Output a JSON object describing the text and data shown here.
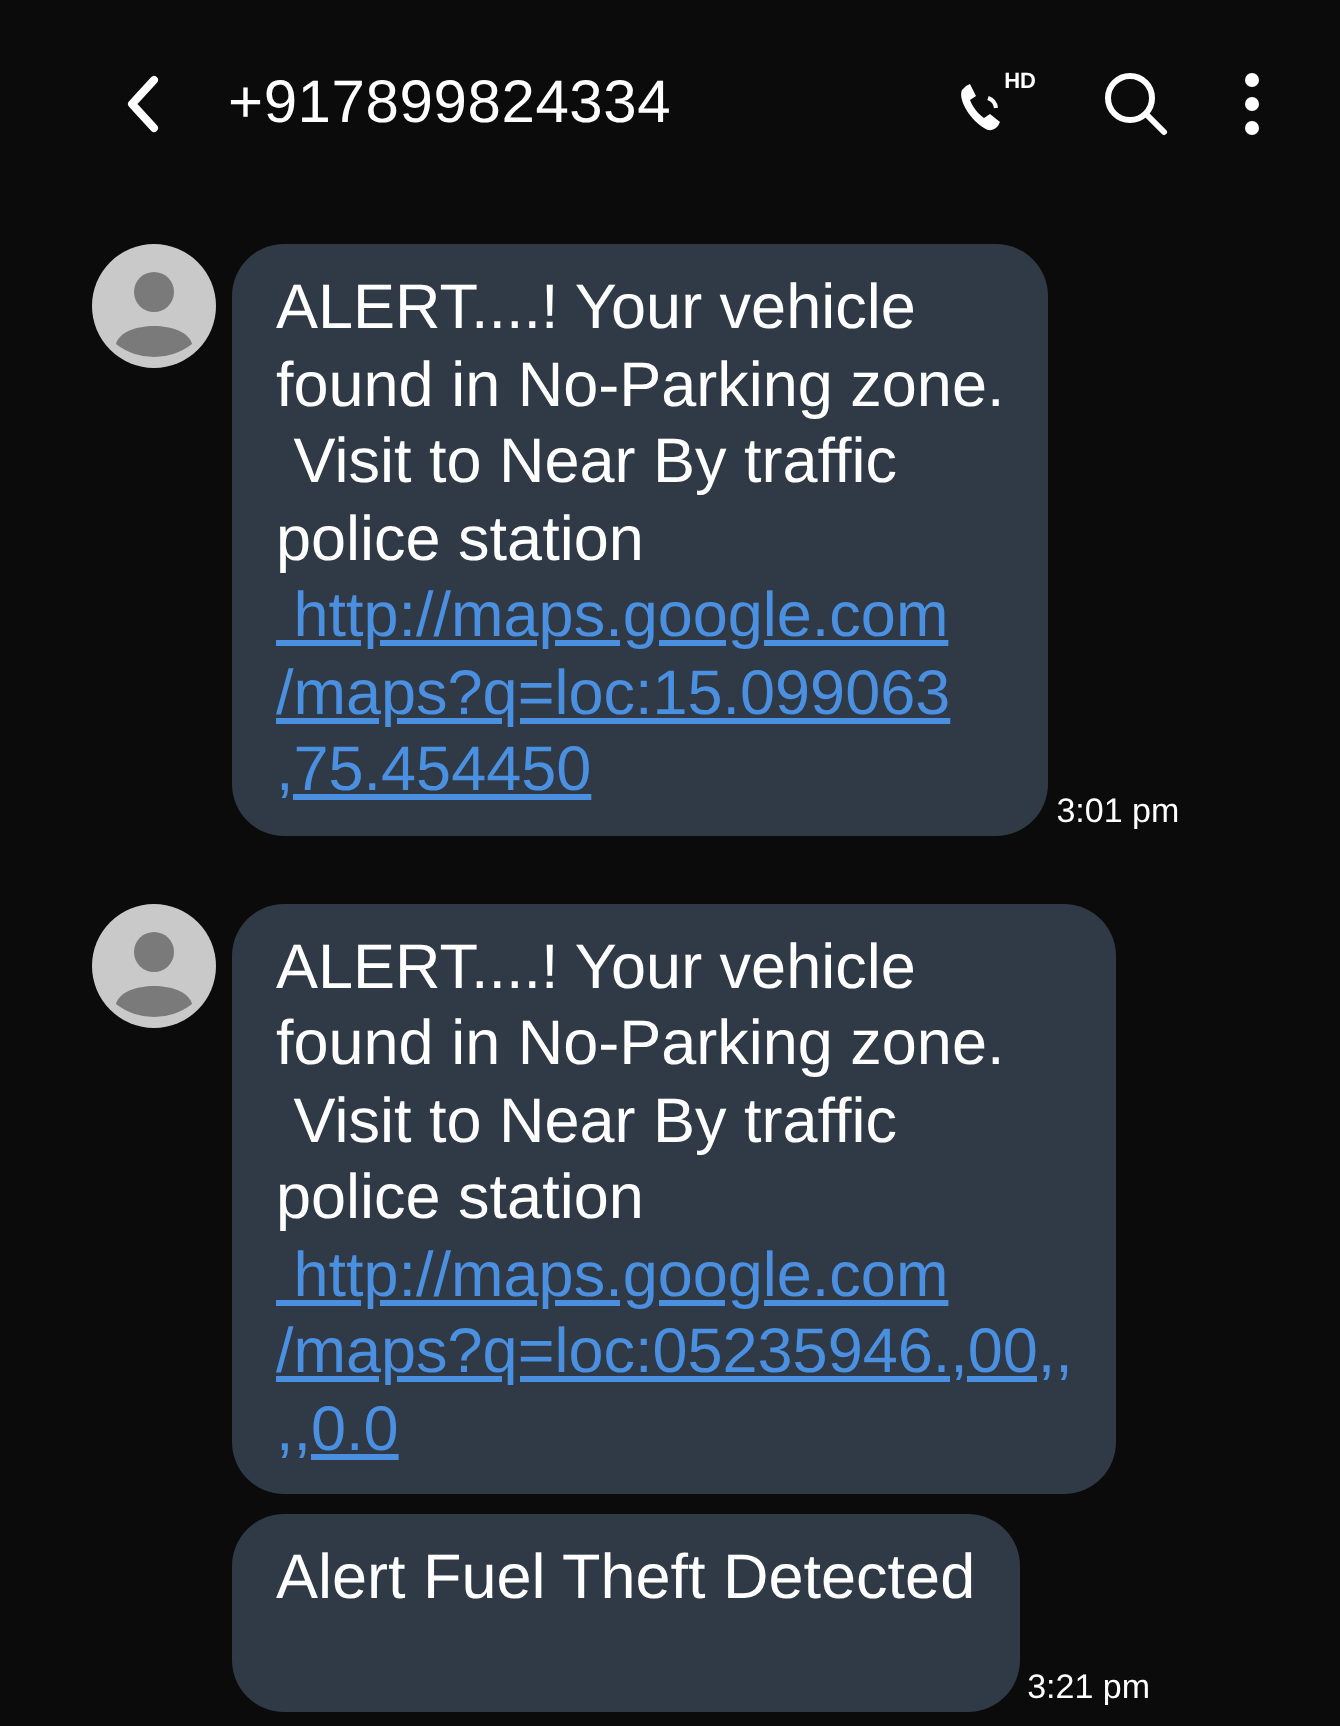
{
  "header": {
    "title": "+917899824334",
    "hd_badge": "HD"
  },
  "messages": [
    {
      "avatar": true,
      "text": "ALERT....! Your vehicle\nfound in No-Parking zone.\n Visit to Near By traffic\npolice station",
      "link": " http://maps.google.com\n/maps?q=loc:15.099063\n,75.454450",
      "time": "3:01 pm"
    },
    {
      "avatar": true,
      "text": "ALERT....! Your vehicle\nfound in No-Parking zone.\n Visit to Near By traffic\npolice station",
      "link": " http://maps.google.com\n/maps?q=loc:05235946.,00,,\n,,0.0"
    },
    {
      "avatar": false,
      "text": "Alert Fuel Theft Detected",
      "time": "3:21 pm"
    }
  ]
}
